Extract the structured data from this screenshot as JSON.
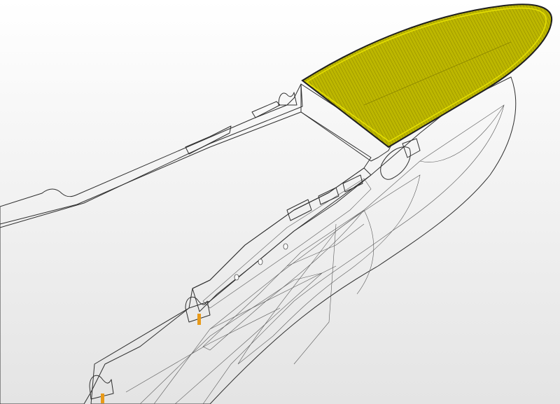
{
  "viewport": {
    "background_top": "#ffffff",
    "background_bottom": "#e4e4e4"
  },
  "model": {
    "deck_color": "#d4d400",
    "bow_deck_color": "#b9b300",
    "hull_color": "#b2b1a8",
    "hull_shadow_color": "#8f8e86",
    "hull_light_color": "#d3d2cb",
    "edge_color": "#2f2f2f",
    "marker_color": "#e89a1a",
    "icons": [
      "boat-hull-icon"
    ]
  }
}
